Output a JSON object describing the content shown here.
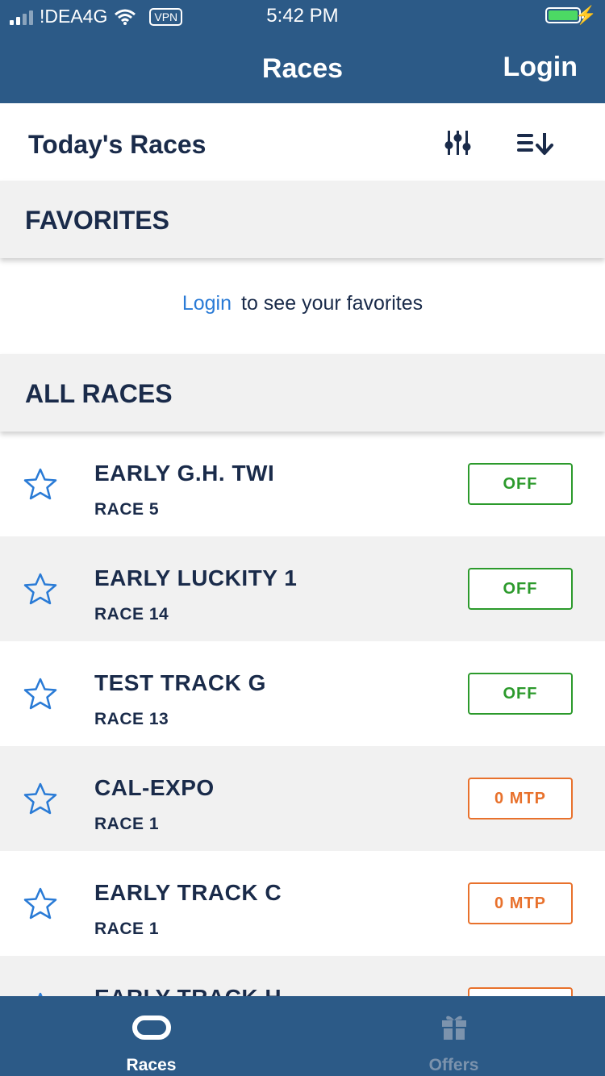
{
  "status_bar": {
    "carrier": "!DEA4G",
    "vpn": "VPN",
    "time": "5:42 PM"
  },
  "nav": {
    "title": "Races",
    "login": "Login"
  },
  "subheader": {
    "title": "Today's Races"
  },
  "favorites": {
    "title": "FAVORITES",
    "login_link": "Login",
    "message": "to see your favorites"
  },
  "all_races": {
    "title": "ALL RACES"
  },
  "races": [
    {
      "name": "EARLY G.H. TWI",
      "race": "RACE 5",
      "status": "OFF"
    },
    {
      "name": "EARLY LUCKITY 1",
      "race": "RACE 14",
      "status": "OFF"
    },
    {
      "name": "TEST TRACK G",
      "race": "RACE 13",
      "status": "OFF"
    },
    {
      "name": "CAL-EXPO",
      "race": "RACE 1",
      "status": "0 MTP"
    },
    {
      "name": "EARLY TRACK C",
      "race": "RACE 1",
      "status": "0 MTP"
    },
    {
      "name": "EARLY TRACK H",
      "race": "",
      "status": ""
    }
  ],
  "tabs": [
    {
      "label": "Races"
    },
    {
      "label": "Offers"
    }
  ],
  "colors": {
    "primary": "#2c5a87",
    "off": "#2c9a2c",
    "mtp": "#e8712c",
    "link": "#2a7bd6",
    "text": "#1a2b4a"
  }
}
